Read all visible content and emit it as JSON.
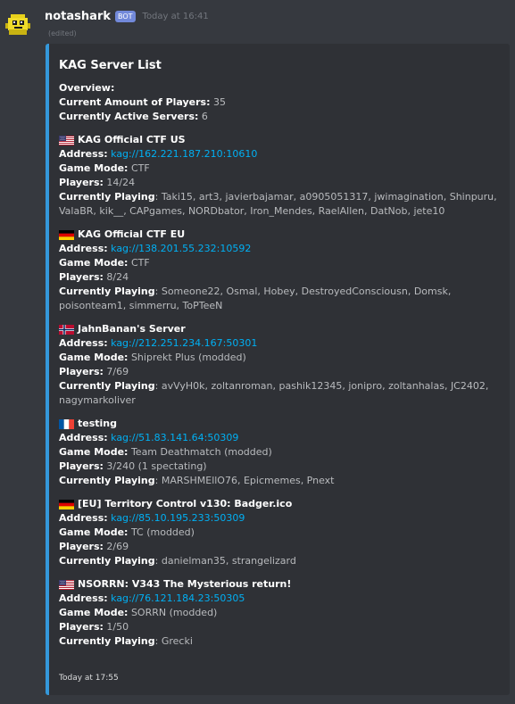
{
  "message": {
    "username": "notashark",
    "bot_tag": "BOT",
    "timestamp": "Today at 16:41",
    "edited": "(edited)"
  },
  "embed": {
    "accent_color": "#3498db",
    "title": "KAG Server List",
    "overview": {
      "heading": "Overview:",
      "players_label": "Current Amount of Players:",
      "players_value": "35",
      "servers_label": "Currently Active Servers:",
      "servers_value": "6"
    },
    "labels": {
      "address": "Address:",
      "game_mode": "Game Mode:",
      "players": "Players:",
      "playing": "Currently Playing"
    },
    "servers": [
      {
        "flag": "us-flag-icon",
        "name": "KAG Official CTF US",
        "address": "kag://162.221.187.210:10610",
        "game_mode": "CTF",
        "players": "14/24",
        "playing": "Taki15, art3, javierbajamar, a0905051317, jwimagination, Shinpuru, ValaBR, kik__, CAPgames, NORDbator, Iron_Mendes, RaelAllen, DatNob, jete10"
      },
      {
        "flag": "de-flag-icon",
        "name": "KAG Official CTF EU",
        "address": "kag://138.201.55.232:10592",
        "game_mode": "CTF",
        "players": "8/24",
        "playing": "Someone22, Osmal, Hobey, DestroyedConsciousn, Domsk, poisonteam1, simmerru, ToPTeeN"
      },
      {
        "flag": "no-flag-icon",
        "name": "JahnBanan's Server",
        "address": "kag://212.251.234.167:50301",
        "game_mode": "Shiprekt Plus (modded)",
        "players": "7/69",
        "playing": "avVyH0k, zoltanroman, pashik12345, jonipro, zoltanhalas, JC2402, nagymarkoliver"
      },
      {
        "flag": "fr-flag-icon",
        "name": "testing",
        "address": "kag://51.83.141.64:50309",
        "game_mode": "Team Deathmatch (modded)",
        "players": "3/240 (1 spectating)",
        "playing": "MARSHMEllO76, Epicmemes, Pnext"
      },
      {
        "flag": "de-flag-icon",
        "name": "[EU] Territory Control v130: Badger.ico",
        "address": "kag://85.10.195.233:50309",
        "game_mode": "TC (modded)",
        "players": "2/69",
        "playing": "danielman35, strangelizard"
      },
      {
        "flag": "us-flag-icon",
        "name": "NSORRN: V343 The Mysterious return!",
        "address": "kag://76.121.184.23:50305",
        "game_mode": "SORRN (modded)",
        "players": "1/50",
        "playing": "Grecki"
      }
    ],
    "footer": "Today at 17:55"
  }
}
